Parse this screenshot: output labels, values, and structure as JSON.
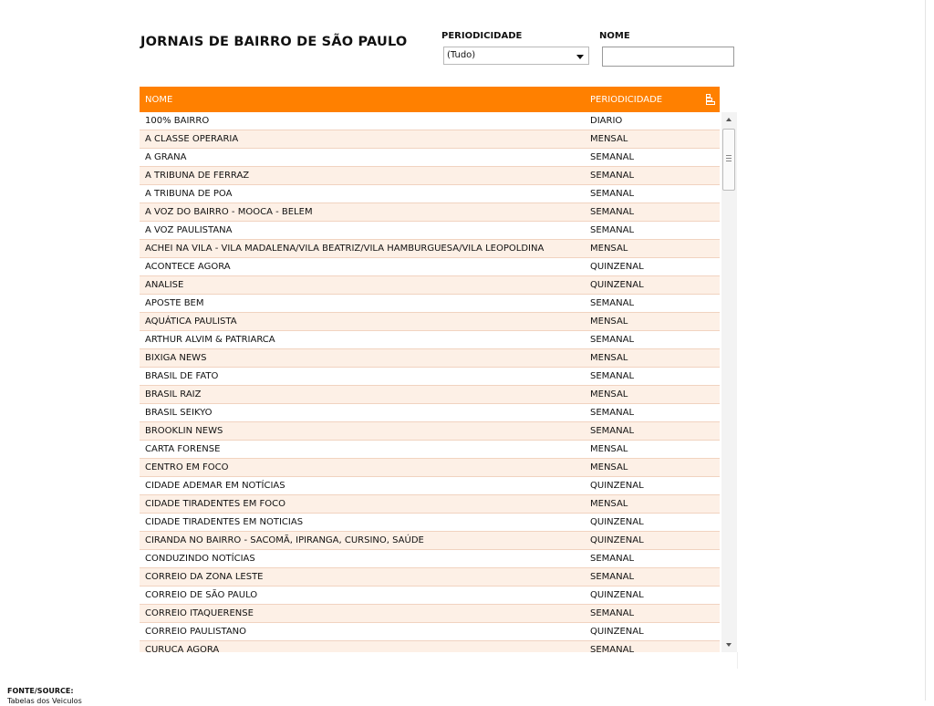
{
  "page": {
    "title": "JORNAIS DE BAIRRO DE SÃO PAULO"
  },
  "filters": {
    "periodicidade_label": "PERIODICIDADE",
    "periodicidade_value": "(Tudo)",
    "nome_label": "NOME",
    "nome_value": ""
  },
  "table": {
    "columns": [
      "NOME",
      "PERIODICIDADE"
    ],
    "sort_icon": "sort-icon",
    "rows": [
      [
        "100% BAIRRO",
        "DIARIO"
      ],
      [
        "A CLASSE OPERARIA",
        "MENSAL"
      ],
      [
        "A GRANA",
        "SEMANAL"
      ],
      [
        "A TRIBUNA DE FERRAZ",
        "SEMANAL"
      ],
      [
        "A TRIBUNA DE POA",
        "SEMANAL"
      ],
      [
        "A VOZ DO BAIRRO - MOOCA - BELEM",
        "SEMANAL"
      ],
      [
        "A VOZ PAULISTANA",
        "SEMANAL"
      ],
      [
        "ACHEI NA VILA - VILA MADALENA/VILA BEATRIZ/VILA HAMBURGUESA/VILA LEOPOLDINA",
        "MENSAL"
      ],
      [
        "ACONTECE AGORA",
        "QUINZENAL"
      ],
      [
        "ANALISE",
        "QUINZENAL"
      ],
      [
        "APOSTE BEM",
        "SEMANAL"
      ],
      [
        "AQUÁTICA PAULISTA",
        "MENSAL"
      ],
      [
        "ARTHUR ALVIM & PATRIARCA",
        "SEMANAL"
      ],
      [
        "BIXIGA NEWS",
        "MENSAL"
      ],
      [
        "BRASIL DE FATO",
        "SEMANAL"
      ],
      [
        "BRASIL RAIZ",
        "MENSAL"
      ],
      [
        "BRASIL SEIKYO",
        "SEMANAL"
      ],
      [
        "BROOKLIN NEWS",
        "SEMANAL"
      ],
      [
        "CARTA FORENSE",
        "MENSAL"
      ],
      [
        "CENTRO EM FOCO",
        "MENSAL"
      ],
      [
        "CIDADE ADEMAR EM NOTÍCIAS",
        "QUINZENAL"
      ],
      [
        "CIDADE TIRADENTES EM FOCO",
        "MENSAL"
      ],
      [
        "CIDADE TIRADENTES EM NOTICIAS",
        "QUINZENAL"
      ],
      [
        "CIRANDA NO BAIRRO - SACOMÃ, IPIRANGA, CURSINO, SAÚDE",
        "QUINZENAL"
      ],
      [
        "CONDUZINDO NOTÍCIAS",
        "SEMANAL"
      ],
      [
        "CORREIO DA ZONA LESTE",
        "SEMANAL"
      ],
      [
        "CORREIO DE SÃO PAULO",
        "QUINZENAL"
      ],
      [
        "CORREIO ITAQUERENSE",
        "SEMANAL"
      ],
      [
        "CORREIO PAULISTANO",
        "QUINZENAL"
      ],
      [
        "CURUCA AGORA",
        "SEMANAL"
      ]
    ]
  },
  "scrollbar": {
    "position_fraction": 0.0
  },
  "footer": {
    "source_label": "FONTE/SOURCE:",
    "source_value": "Tabelas dos Veiculos"
  }
}
